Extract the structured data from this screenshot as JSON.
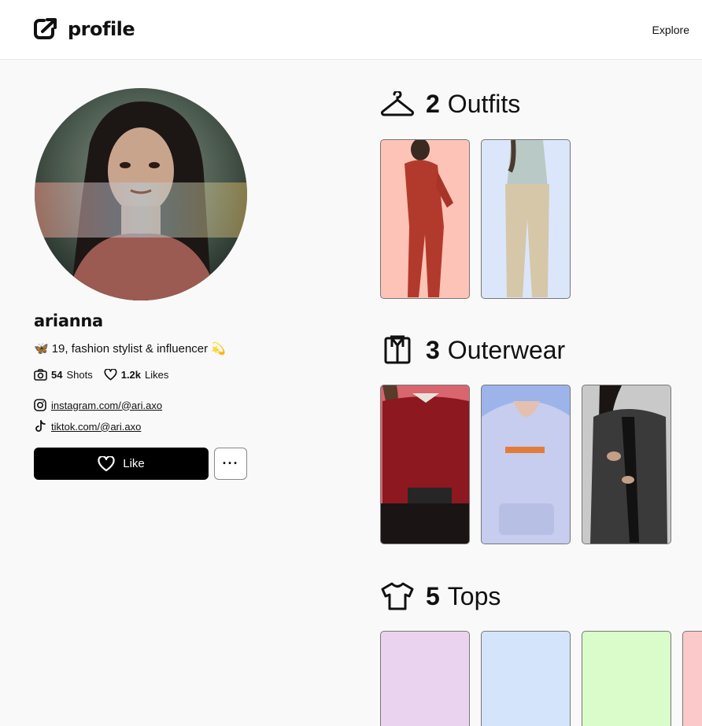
{
  "header": {
    "logo_text": "profile",
    "nav_explore": "Explore"
  },
  "profile": {
    "username": "arianna",
    "bio_emoji": "🦋",
    "bio_text": "19, fashion stylist & influencer",
    "bio_emoji_end": "💫",
    "shots_count": "54",
    "shots_label": "Shots",
    "likes_count": "1.2k",
    "likes_label": "Likes",
    "instagram": "instagram.com/@ari.axo",
    "tiktok": "tiktok.com/@ari.axo",
    "like_button": "Like",
    "more_button": "···"
  },
  "sections": [
    {
      "count": "2",
      "label": "Outfits",
      "icon": "hanger-icon",
      "card_colors": [
        "#fdc3b6",
        "#dbe6fb"
      ]
    },
    {
      "count": "3",
      "label": "Outerwear",
      "icon": "jacket-icon",
      "card_colors": [
        "#d9656e",
        "#9cb4ea",
        "#c9c9c9"
      ]
    },
    {
      "count": "5",
      "label": "Tops",
      "icon": "tshirt-icon",
      "card_colors": [
        "#ead3ef",
        "#d4e5fb",
        "#d9fcca",
        "#fbc9c9"
      ]
    }
  ]
}
